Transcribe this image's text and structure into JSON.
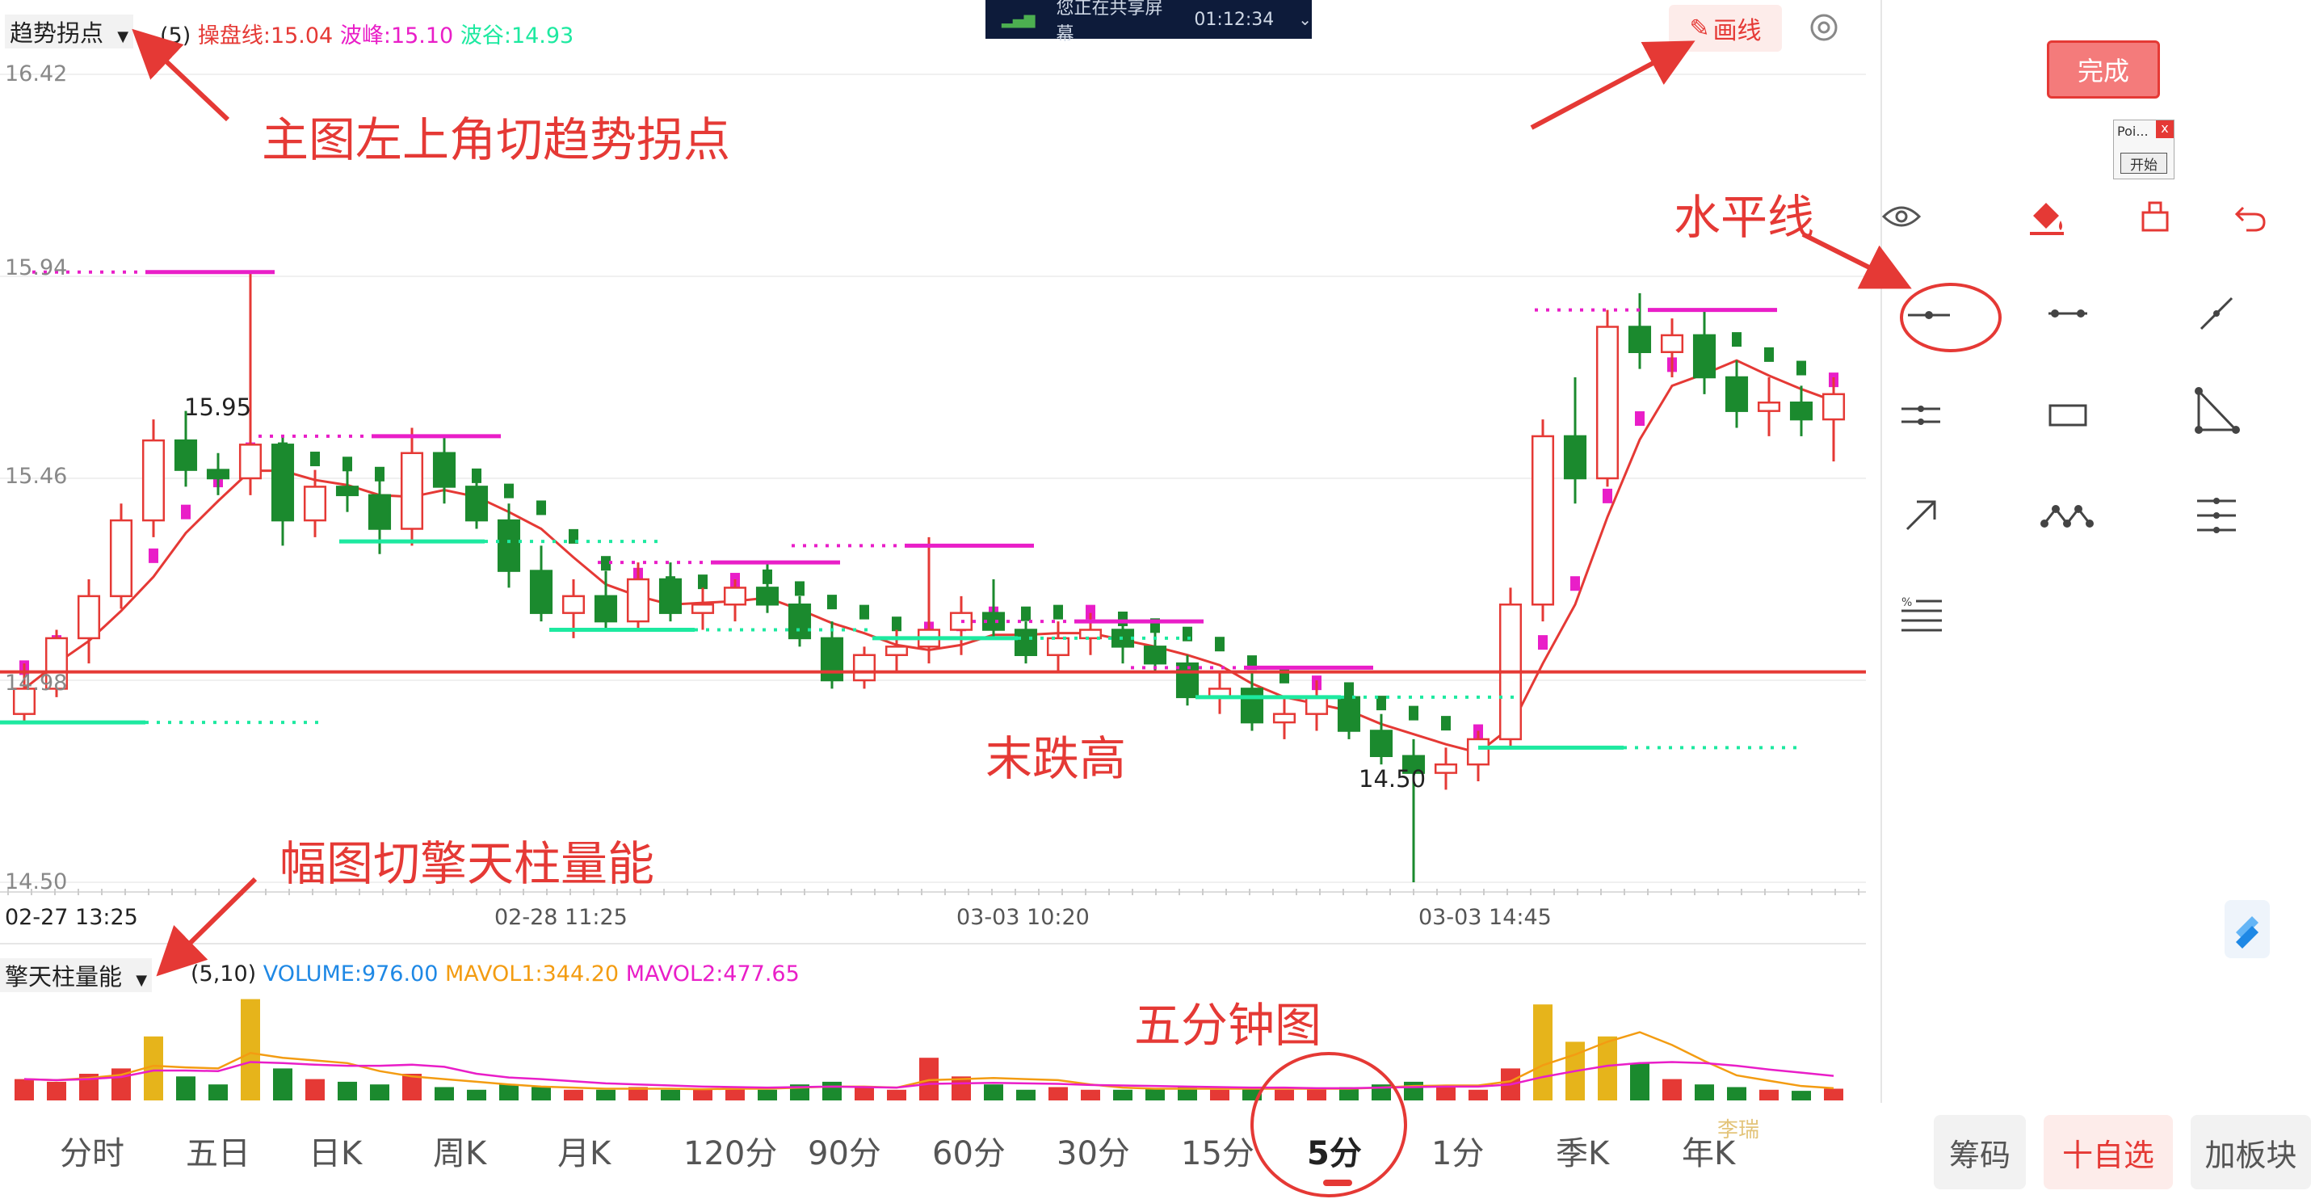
{
  "header": {
    "indicator_selector": "趋势拐点",
    "param": "(5)",
    "line1": "操盘线:15.04",
    "line2": "波峰:15.10",
    "line3": "波谷:14.93"
  },
  "share_bar": {
    "text": "您正在共享屏幕",
    "time": "01:12:34"
  },
  "draw_button": "画线",
  "done_button": "完成",
  "popup": {
    "title": "Poi...",
    "close": "x",
    "start": "开始"
  },
  "annotations": {
    "a1": "主图左上角切趋势拐点",
    "a2": "水平线",
    "a3": "末跌高",
    "a4": "幅图切擎天柱量能",
    "a5": "五分钟图"
  },
  "price_labels": {
    "high": "15.95",
    "low": "14.50"
  },
  "y_ticks": [
    "16.42",
    "15.94",
    "15.46",
    "14.98",
    "14.50"
  ],
  "x_ticks": [
    "02-27 13:25",
    "02-28 11:25",
    "03-03 10:20",
    "03-03 14:45"
  ],
  "volume_header": {
    "selector": "擎天柱量能",
    "param": "(5,10)",
    "volume": "VOLUME:976.00",
    "mavol1": "MAVOL1:344.20",
    "mavol2": "MAVOL2:477.65"
  },
  "tabs": [
    "分时",
    "五日",
    "日K",
    "周K",
    "月K",
    "120分",
    "90分",
    "60分",
    "30分",
    "15分",
    "5分",
    "1分",
    "季K",
    "年K"
  ],
  "active_tab": "5分",
  "watermark": "李瑞",
  "bottom_buttons": {
    "chips": "筹码",
    "add": "十自选",
    "board": "加板块"
  },
  "colors": {
    "up": "#e53935",
    "down": "#1b8a2e",
    "peak": "#e91ec8",
    "trough": "#1de9a0",
    "accent": "#e53935",
    "volume_hi": "#e6b41b"
  },
  "chart_data": {
    "type": "candlestick",
    "ylim": [
      14.5,
      16.42
    ],
    "y_ticks": [
      14.5,
      14.98,
      15.46,
      15.94,
      16.42
    ],
    "x_labels": [
      "02-27 13:25",
      "02-28 11:25",
      "03-03 10:20",
      "03-03 14:45"
    ],
    "horizontal_line": 15.0,
    "peak_levels": [
      15.95,
      15.56,
      15.26,
      15.3,
      15.12,
      15.01,
      15.86
    ],
    "trough_levels": [
      14.88,
      15.31,
      15.1,
      15.08,
      14.94,
      14.82
    ],
    "ohlc": [
      [
        14.9,
        15.02,
        14.88,
        14.96
      ],
      [
        14.96,
        15.1,
        14.94,
        15.08
      ],
      [
        15.08,
        15.22,
        15.02,
        15.18
      ],
      [
        15.18,
        15.4,
        15.15,
        15.36
      ],
      [
        15.36,
        15.6,
        15.32,
        15.55
      ],
      [
        15.55,
        15.62,
        15.44,
        15.48
      ],
      [
        15.48,
        15.52,
        15.42,
        15.46
      ],
      [
        15.46,
        15.95,
        15.42,
        15.54
      ],
      [
        15.54,
        15.56,
        15.3,
        15.36
      ],
      [
        15.36,
        15.48,
        15.32,
        15.44
      ],
      [
        15.44,
        15.5,
        15.38,
        15.42
      ],
      [
        15.42,
        15.46,
        15.28,
        15.34
      ],
      [
        15.34,
        15.58,
        15.3,
        15.52
      ],
      [
        15.52,
        15.56,
        15.4,
        15.44
      ],
      [
        15.44,
        15.46,
        15.34,
        15.36
      ],
      [
        15.36,
        15.4,
        15.2,
        15.24
      ],
      [
        15.24,
        15.3,
        15.12,
        15.14
      ],
      [
        15.14,
        15.22,
        15.08,
        15.18
      ],
      [
        15.18,
        15.24,
        15.1,
        15.12
      ],
      [
        15.12,
        15.26,
        15.1,
        15.22
      ],
      [
        15.22,
        15.26,
        15.12,
        15.14
      ],
      [
        15.14,
        15.2,
        15.1,
        15.16
      ],
      [
        15.16,
        15.22,
        15.12,
        15.2
      ],
      [
        15.2,
        15.26,
        15.14,
        15.16
      ],
      [
        15.16,
        15.18,
        15.06,
        15.08
      ],
      [
        15.08,
        15.12,
        14.96,
        14.98
      ],
      [
        14.98,
        15.06,
        14.96,
        15.04
      ],
      [
        15.04,
        15.1,
        15.0,
        15.06
      ],
      [
        15.06,
        15.32,
        15.02,
        15.1
      ],
      [
        15.1,
        15.18,
        15.04,
        15.14
      ],
      [
        15.14,
        15.22,
        15.08,
        15.1
      ],
      [
        15.1,
        15.12,
        15.02,
        15.04
      ],
      [
        15.04,
        15.12,
        15.0,
        15.08
      ],
      [
        15.08,
        15.14,
        15.04,
        15.1
      ],
      [
        15.1,
        15.14,
        15.02,
        15.06
      ],
      [
        15.06,
        15.1,
        15.0,
        15.02
      ],
      [
        15.02,
        15.04,
        14.92,
        14.94
      ],
      [
        14.94,
        15.0,
        14.9,
        14.96
      ],
      [
        14.96,
        15.0,
        14.86,
        14.88
      ],
      [
        14.88,
        14.94,
        14.84,
        14.9
      ],
      [
        14.9,
        14.98,
        14.86,
        14.94
      ],
      [
        14.94,
        14.96,
        14.84,
        14.86
      ],
      [
        14.86,
        14.9,
        14.78,
        14.8
      ],
      [
        14.8,
        14.84,
        14.5,
        14.76
      ],
      [
        14.76,
        14.82,
        14.72,
        14.78
      ],
      [
        14.78,
        14.86,
        14.74,
        14.84
      ],
      [
        14.84,
        15.2,
        14.82,
        15.16
      ],
      [
        15.16,
        15.6,
        15.12,
        15.56
      ],
      [
        15.56,
        15.7,
        15.4,
        15.46
      ],
      [
        15.46,
        15.86,
        15.44,
        15.82
      ],
      [
        15.82,
        15.9,
        15.72,
        15.76
      ],
      [
        15.76,
        15.84,
        15.7,
        15.8
      ],
      [
        15.8,
        15.86,
        15.66,
        15.7
      ],
      [
        15.7,
        15.74,
        15.58,
        15.62
      ],
      [
        15.62,
        15.7,
        15.56,
        15.64
      ],
      [
        15.64,
        15.68,
        15.56,
        15.6
      ],
      [
        15.6,
        15.7,
        15.5,
        15.66
      ]
    ],
    "volume": [
      40,
      35,
      50,
      60,
      120,
      45,
      30,
      190,
      60,
      40,
      35,
      30,
      50,
      25,
      20,
      30,
      25,
      20,
      20,
      25,
      20,
      20,
      25,
      20,
      30,
      35,
      25,
      20,
      80,
      45,
      30,
      20,
      25,
      20,
      20,
      22,
      25,
      20,
      22,
      20,
      22,
      25,
      30,
      35,
      25,
      20,
      60,
      180,
      110,
      120,
      70,
      40,
      30,
      25,
      20,
      18,
      22
    ],
    "mavol1": [
      40,
      38,
      42,
      48,
      65,
      62,
      60,
      89,
      80,
      75,
      70,
      55,
      45,
      40,
      35,
      30,
      26,
      24,
      22,
      22,
      22,
      21,
      22,
      22,
      24,
      26,
      26,
      24,
      38,
      40,
      42,
      40,
      38,
      30,
      24,
      22,
      22,
      22,
      22,
      22,
      22,
      22,
      24,
      27,
      28,
      28,
      36,
      66,
      86,
      110,
      128,
      104,
      74,
      47,
      37,
      27,
      23
    ],
    "mavol2": [
      40,
      38,
      40,
      44,
      56,
      56,
      55,
      72,
      70,
      67,
      65,
      65,
      67,
      63,
      50,
      43,
      40,
      36,
      32,
      30,
      28,
      26,
      25,
      24,
      25,
      26,
      25,
      24,
      31,
      32,
      33,
      32,
      31,
      29,
      28,
      27,
      26,
      25,
      24,
      24,
      23,
      23,
      24,
      25,
      26,
      26,
      30,
      44,
      55,
      65,
      70,
      72,
      70,
      65,
      58,
      52,
      46
    ]
  }
}
